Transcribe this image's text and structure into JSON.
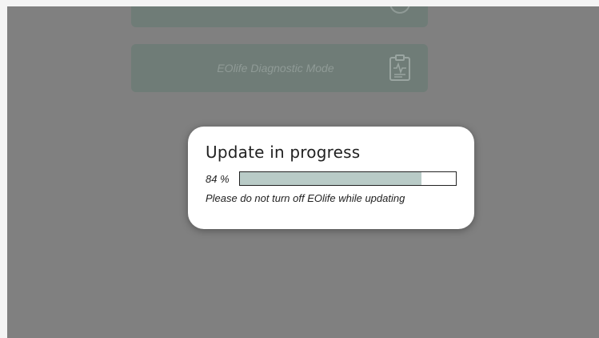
{
  "background": {
    "buttons": [
      {
        "label": "",
        "icon": "clock-icon"
      },
      {
        "label": "EOlife Diagnostic Mode",
        "icon": "clipboard-chart-icon"
      }
    ]
  },
  "dialog": {
    "title": "Update in progress",
    "progress_text": "84 %",
    "progress_value": 0.84,
    "note": "Please do not turn off EOlife while updating",
    "progress_fill_color": "#b9cbc7"
  },
  "colors": {
    "overlay": "#808080",
    "dialog_bg": "#ffffff",
    "button_bg": "#6f7c77"
  }
}
